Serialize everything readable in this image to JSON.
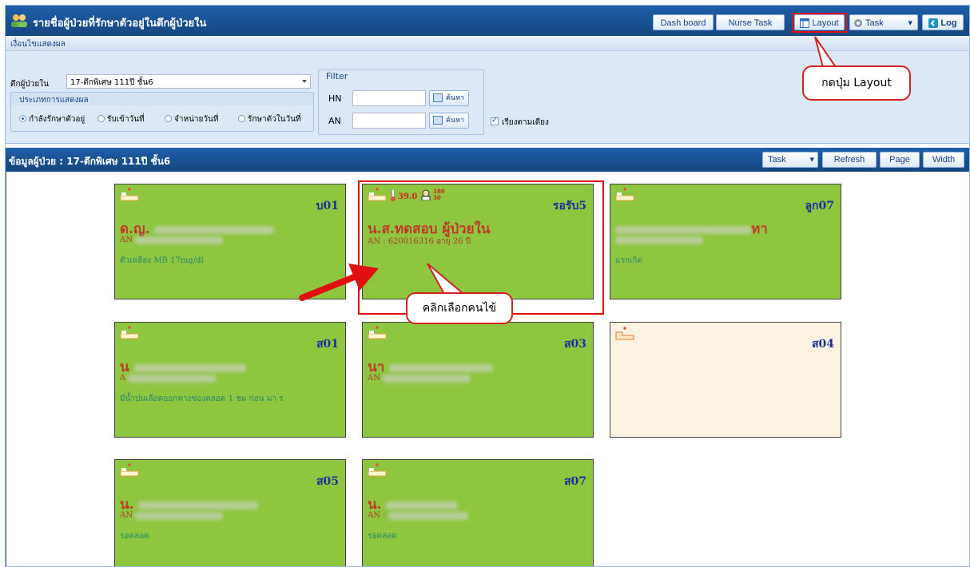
{
  "header": {
    "title": "รายชื่อผู้ป่วยที่รักษาตัวอยู่ในตึกผู้ป่วยใน",
    "buttons": {
      "dashboard": "Dash board",
      "nurse_task": "Nurse Task",
      "layout": "Layout",
      "task": "Task",
      "log": "Log"
    }
  },
  "filter_panel": {
    "section_title": "เงื่อนไขแสดงผล",
    "ward_label": "ตึกผู้ป่วยใน",
    "ward_value": "17-ตึกพิเศษ 111ปี ชั้น6",
    "display_type_title": "ประเภทการแสดงผล",
    "radios": [
      "กำลังรักษาตัวอยู่",
      "รับเข้าวันที่",
      "จำหน่ายวันที่",
      "รักษาตัวในวันที่"
    ],
    "selected_radio": 0,
    "filter_legend": "Filter",
    "hn_label": "HN",
    "an_label": "AN",
    "search_label": "ค้นหา",
    "sort_by_bed_label": "เรียงตามเตียง"
  },
  "patient_panel": {
    "title": "ข้อมูลผู้ป่วย : 17-ตึกพิเศษ 111ปี ชั้น6",
    "buttons": {
      "task": "Task",
      "refresh": "Refresh",
      "page": "Page",
      "width": "Width"
    }
  },
  "annotations": {
    "layout_callout": "กดปุ่ม Layout",
    "click_callout": "คลิกเลือกคนไข้"
  },
  "cards": [
    {
      "bed": "บ01",
      "name": "ด.ญ.",
      "an": "AN",
      "note": "ตัวเหลือง MB 17mg/dl"
    },
    {
      "bed": "รอรับ5",
      "name": "น.ส.ทดสอบ ผู้ป่วยใน",
      "an": "AN : 620016316   อายุ 26 ปี",
      "note": "",
      "temp": "39.0",
      "bp_top": "180",
      "bp_bottom": "30"
    },
    {
      "bed": "ลูก07",
      "name": "",
      "an": "",
      "note": "แรกเกิด"
    },
    {
      "bed": "ส01",
      "name": "น",
      "an": "A",
      "note": "มีน้ำปนเลือดออกทางช่องคลอด 1 ชม ก่อน มา ร"
    },
    {
      "bed": "ส03",
      "name": "นา",
      "an": "AN",
      "note": ""
    },
    {
      "bed": "ส04",
      "name": "",
      "an": "",
      "note": "",
      "empty": true
    },
    {
      "bed": "ส05",
      "name": "น.",
      "an": "AN",
      "note": "รอคลอด"
    },
    {
      "bed": "ส07",
      "name": "น.",
      "an": "AN :",
      "note": "รอคลอด"
    }
  ]
}
